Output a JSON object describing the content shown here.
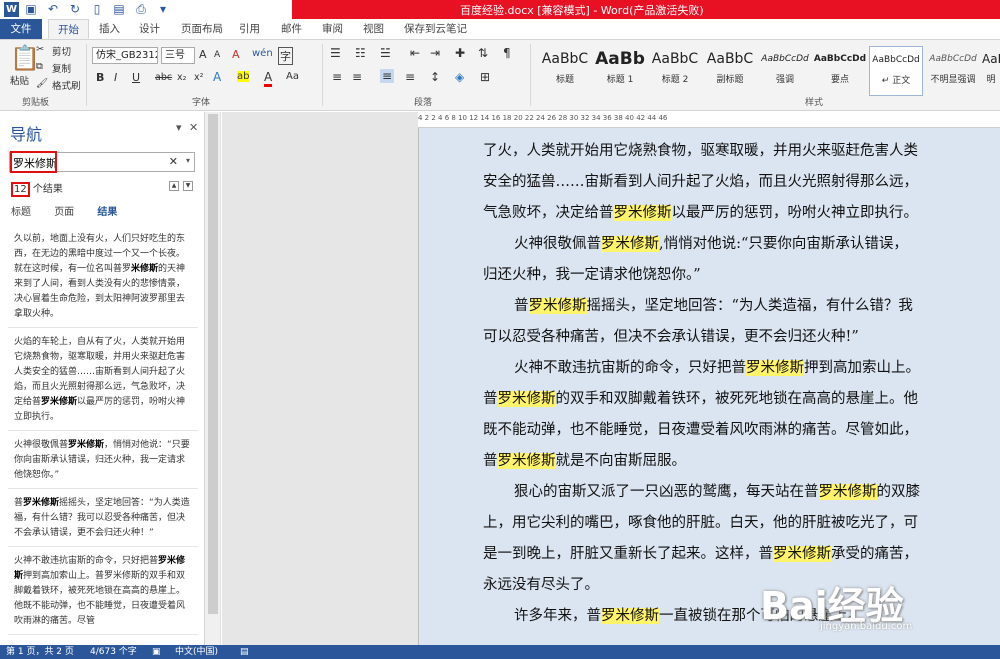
{
  "window": {
    "title": "百度经验.docx [兼容模式] - Word(产品激活失败)",
    "word_icon": "W"
  },
  "tabs": [
    {
      "label": "文件"
    },
    {
      "label": "开始"
    },
    {
      "label": "插入"
    },
    {
      "label": "设计"
    },
    {
      "label": "页面布局"
    },
    {
      "label": "引用"
    },
    {
      "label": "邮件"
    },
    {
      "label": "审阅"
    },
    {
      "label": "视图"
    },
    {
      "label": "保存到云笔记"
    }
  ],
  "ribbon": {
    "clipboard": {
      "paste": "粘贴",
      "cut": "剪切",
      "copy": "复制",
      "format_painter": "格式刷",
      "label": "剪贴板"
    },
    "font": {
      "name": "仿宋_GB2312",
      "size": "三号",
      "label": "字体",
      "grow": "A",
      "shrink": "A",
      "clear": "A",
      "bold": "B",
      "italic": "I",
      "underline": "U",
      "strike": "abc",
      "sub": "x₂",
      "sup": "x²",
      "effects": "A",
      "highlight": "ab",
      "color": "A",
      "case": "Aa",
      "phonetic": "wén",
      "enclosed": "字"
    },
    "paragraph": {
      "label": "段落"
    },
    "styles": {
      "label": "样式",
      "items": [
        {
          "sample": "AaBbC",
          "name": "标题"
        },
        {
          "sample": "AaBb",
          "name": "标题 1"
        },
        {
          "sample": "AaBbC",
          "name": "标题 2"
        },
        {
          "sample": "AaBbC",
          "name": "副标题"
        },
        {
          "sample": "AaBbCcDd",
          "name": "强调"
        },
        {
          "sample": "AaBbCcDd",
          "name": "要点"
        },
        {
          "sample": "AaBbCcDd",
          "name": "↵ 正文"
        },
        {
          "sample": "AaBbCcDd",
          "name": "不明显强调"
        },
        {
          "sample": "AaB",
          "name": "明"
        }
      ]
    }
  },
  "nav": {
    "title": "导航",
    "search_value": "罗米修斯",
    "result_count": "12",
    "result_suffix": "个结果",
    "tabs": [
      "标题",
      "页面",
      "结果"
    ],
    "results": [
      {
        "pre": "久以前，地面上没有火，人们只好吃生的东西，在无边的黑暗中度过一个又一个长夜。就在这时候，有一位名叫普罗",
        "hit": "米修斯",
        "post": "的天神来到了人间，看到人类没有火的悲惨情景，决心冒着生命危险，到太阳神阿波罗那里去拿取火种。"
      },
      {
        "pre": "火焰的车轮上，自从有了火，人类就开始用它烧熟食物，驱寒取暖，并用火来驱赶危害人类安全的猛兽……宙斯看到人间升起了火焰，而且火光照射得那么远，气急败坏，决定给普",
        "hit": "罗米修斯",
        "post": "以最严厉的惩罚，吩咐火神立即执行。"
      },
      {
        "pre": "火神很敬佩普",
        "hit": "罗米修斯",
        "post": "，悄悄对他说：“只要你向宙斯承认错误，归还火种，我一定请求他饶恕你。”"
      },
      {
        "pre": "普",
        "hit": "罗米修斯",
        "post": "摇摇头，坚定地回答：“为人类造福，有什么错？我可以忍受各种痛苦，但决不会承认错误，更不会归还火种！”"
      },
      {
        "pre": "火神不敢违抗宙斯的命令，只好把普",
        "hit": "罗米修斯",
        "post": "押到高加索山上。普罗米修斯的双手和双脚戴着铁环，被死死地锁在高高的悬崖上。他既不能动弹，也不能睡觉，日夜遭受着风吹雨淋的痛苦。尽管"
      }
    ]
  },
  "ruler_text": "4  2     2  4  6  8  10  12  14  16  18  20  22  24  26  28  30  32  34  36  38  40  42  44  46",
  "document": {
    "lines": [
      {
        "indent": false,
        "parts": [
          {
            "t": "了火，人类就开始用它烧熟食物，驱寒取暖，并用火来驱赶危害人类"
          }
        ]
      },
      {
        "indent": false,
        "parts": [
          {
            "t": "安全的猛兽……宙斯看到人间升起了火焰，而且火光照射得那么远，"
          }
        ]
      },
      {
        "indent": false,
        "parts": [
          {
            "t": "气急败坏，决定给普"
          },
          {
            "t": "罗米修斯",
            "h": true
          },
          {
            "t": "以最严厉的惩罚，吩咐火神立即执行。"
          }
        ]
      },
      {
        "indent": true,
        "parts": [
          {
            "t": "火神很敬佩普"
          },
          {
            "t": "罗米修斯",
            "h": true
          },
          {
            "t": ",悄悄对他说:“只要你向宙斯承认错误，"
          }
        ]
      },
      {
        "indent": false,
        "parts": [
          {
            "t": "归还火种，我一定请求他饶恕你。”"
          }
        ]
      },
      {
        "indent": true,
        "parts": [
          {
            "t": "普"
          },
          {
            "t": "罗米修斯",
            "h": true
          },
          {
            "t": "摇摇头，坚定地回答：“为人类造福，有什么错？我"
          }
        ]
      },
      {
        "indent": false,
        "parts": [
          {
            "t": "可以忍受各种痛苦，但决不会承认错误，更不会归还火种!”"
          }
        ]
      },
      {
        "indent": true,
        "parts": [
          {
            "t": "火神不敢违抗宙斯的命令，只好把普"
          },
          {
            "t": "罗米修斯",
            "h": true
          },
          {
            "t": "押到高加索山上。"
          }
        ]
      },
      {
        "indent": false,
        "parts": [
          {
            "t": "普"
          },
          {
            "t": "罗米修斯",
            "h": true
          },
          {
            "t": "的双手和双脚戴着铁环，被死死地锁在高高的悬崖上。他"
          }
        ]
      },
      {
        "indent": false,
        "parts": [
          {
            "t": "既不能动弹，也不能睡觉，日夜遭受着风吹雨淋的痛苦。尽管如此，"
          }
        ]
      },
      {
        "indent": false,
        "parts": [
          {
            "t": "普"
          },
          {
            "t": "罗米修斯",
            "h": true
          },
          {
            "t": "就是不向宙斯屈服。"
          }
        ]
      },
      {
        "indent": true,
        "parts": [
          {
            "t": "狠心的宙斯又派了一只凶恶的鹫鹰，每天站在普"
          },
          {
            "t": "罗米修斯",
            "h": true
          },
          {
            "t": "的双膝"
          }
        ]
      },
      {
        "indent": false,
        "parts": [
          {
            "t": "上，用它尖利的嘴巴，啄食他的肝脏。白天，他的肝脏被吃光了，可"
          }
        ]
      },
      {
        "indent": false,
        "parts": [
          {
            "t": "是一到晚上，肝脏又重新长了起来。这样，普"
          },
          {
            "t": "罗米修斯",
            "h": true
          },
          {
            "t": "承受的痛苦，"
          }
        ]
      },
      {
        "indent": false,
        "parts": [
          {
            "t": "永远没有尽头了。"
          }
        ]
      },
      {
        "indent": true,
        "parts": [
          {
            "t": "许多年来，普"
          },
          {
            "t": "罗米修斯",
            "h": true
          },
          {
            "t": "一直被锁在那个可怕的悬崖上。"
          }
        ]
      }
    ]
  },
  "status": {
    "page": "第 1 页，共 2 页",
    "words": "4/673 个字",
    "lang": "中文(中国)"
  },
  "watermark": {
    "logo": "Bai经验",
    "url": "jingyan.baidu.com"
  },
  "colors": {
    "accent": "#2b579a",
    "title_bar": "#e81123",
    "highlight": "#fff46a",
    "page_bg": "#dbe5f1",
    "annotation": "#e01010"
  }
}
